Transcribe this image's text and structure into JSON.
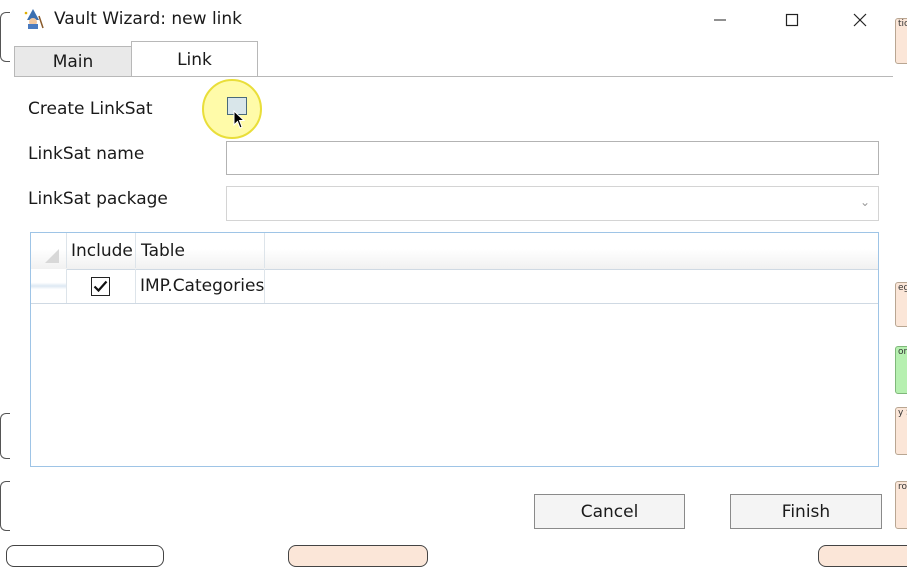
{
  "window": {
    "title": "Vault Wizard: new link",
    "icon": "wizard-icon",
    "controls": [
      "minimize-icon",
      "maximize-icon",
      "close-icon"
    ]
  },
  "tabs": [
    {
      "label": "Main",
      "active": false
    },
    {
      "label": "Link",
      "active": true
    }
  ],
  "form": {
    "create_linksat_label": "Create LinkSat",
    "create_linksat_checked": false,
    "linksat_name_label": "LinkSat name",
    "linksat_name_value": "",
    "linksat_package_label": "LinkSat package",
    "linksat_package_value": ""
  },
  "grid": {
    "columns": [
      "Include",
      "Table"
    ],
    "rows": [
      {
        "include": true,
        "table": "IMP.Categories"
      }
    ]
  },
  "buttons": {
    "cancel": "Cancel",
    "finish": "Finish"
  },
  "background_fragments": [
    "tica",
    "eg",
    "or",
    "y S",
    "ro"
  ],
  "colors": {
    "grid_border": "#9ec4e6",
    "click_highlight": "#fffa8c",
    "bg_card_green": "#b6f0b0",
    "bg_card_peach": "#fbe6d8"
  }
}
